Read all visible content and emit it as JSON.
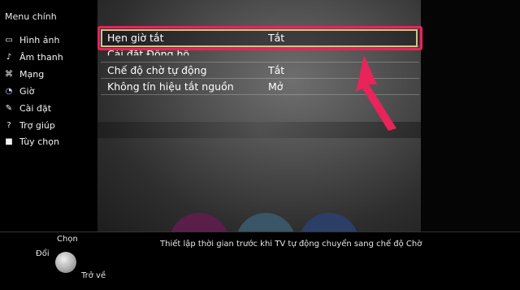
{
  "sidebar": {
    "title": "Menu chính",
    "items": [
      {
        "label": "Hình ảnh",
        "icon": "picture-icon"
      },
      {
        "label": "Âm thanh",
        "icon": "music-note-icon"
      },
      {
        "label": "Mạng",
        "icon": "network-icon"
      },
      {
        "label": "Giờ",
        "icon": "clock-icon"
      },
      {
        "label": "Cài đặt",
        "icon": "wrench-icon"
      },
      {
        "label": "Trợ giúp",
        "icon": "question-icon"
      },
      {
        "label": "Tùy chọn",
        "icon": "options-icon"
      }
    ],
    "active_index": 3
  },
  "submenu": {
    "rows": [
      {
        "label": "Hẹn giờ tắt",
        "value": "Tắt"
      },
      {
        "label": "Cài đặt Đồng hồ",
        "value": ""
      },
      {
        "label": "Chế độ chờ tự động",
        "value": "Tắt"
      },
      {
        "label": "Không tín hiệu tắt nguồn",
        "value": "Mở"
      }
    ],
    "selected_index": 0
  },
  "bottom": {
    "hint": "Thiết lập thời gian trước khi TV tự động chuyển sang chế độ Chờ",
    "controls": {
      "select": "Chọn",
      "change": "Đổi",
      "back": "Trở về"
    }
  },
  "colors": {
    "highlight": "#d7c08a",
    "callout": "#e8245a"
  }
}
